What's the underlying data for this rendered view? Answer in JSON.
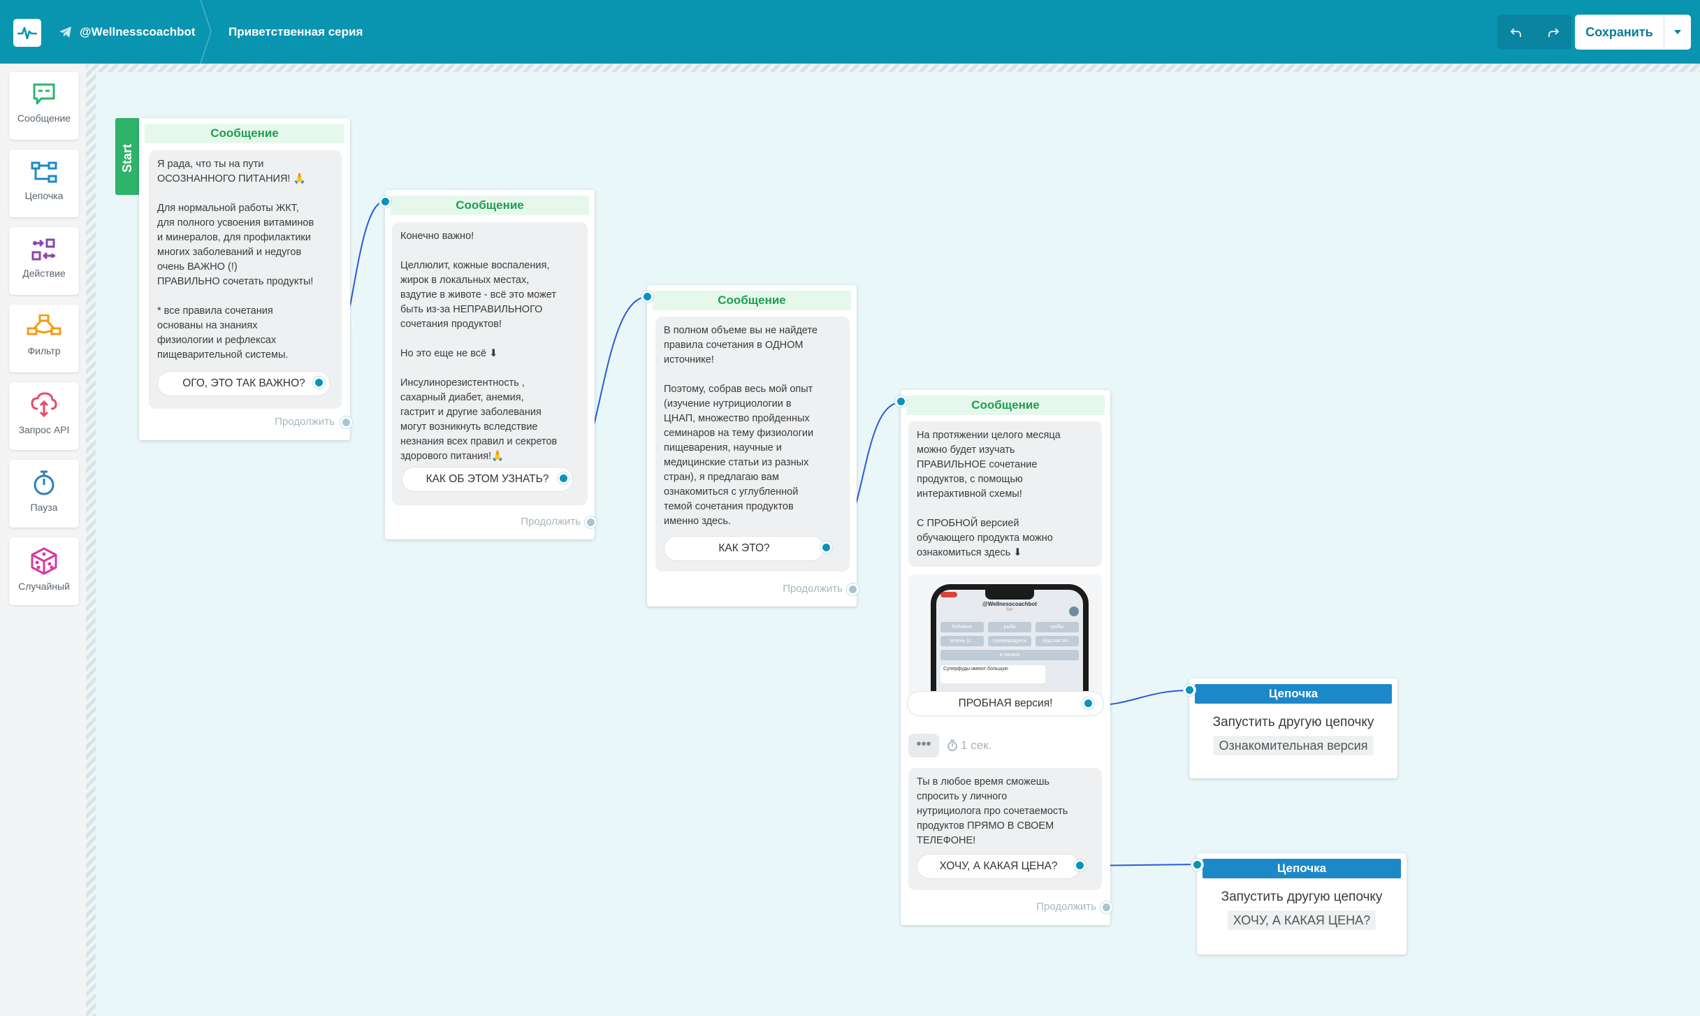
{
  "header": {
    "bot_name": "@Wellnesscoachbot",
    "page_title": "Приветственная серия",
    "save_label": "Сохранить"
  },
  "sidebar": {
    "items": [
      {
        "label": "Сообщение",
        "icon": "message-icon",
        "color": "#2db36a"
      },
      {
        "label": "Цепочка",
        "icon": "chain-icon",
        "color": "#1c88c8"
      },
      {
        "label": "Действие",
        "icon": "action-icon",
        "color": "#8e44ad"
      },
      {
        "label": "Фильтр",
        "icon": "filter-icon",
        "color": "#f39c12"
      },
      {
        "label": "Запрос API",
        "icon": "api-icon",
        "color": "#e74c6c"
      },
      {
        "label": "Пауза",
        "icon": "pause-icon",
        "color": "#2c7fb8"
      },
      {
        "label": "Случайный",
        "icon": "random-icon",
        "color": "#d63aa0"
      }
    ]
  },
  "flow": {
    "start_label": "Start",
    "continue_label": "Продолжить",
    "nodes": [
      {
        "title": "Сообщение",
        "text": "Я рада, что ты на пути\nОСОЗНАННОГО ПИТАНИЯ! 🙏\n\nДля нормальной работы ЖКТ,\nдля полного усвоения витаминов\nи минералов, для профилактики\nмногих заболеваний и недугов\nочень ВАЖНО (!)\nПРАВИЛЬНО сочетать продукты!\n\n* все правила сочетания\nоснованы на знаниях\nфизиологии и рефлексах\nпищеварительной системы.",
        "button": "ОГО, ЭТО ТАК ВАЖНО?"
      },
      {
        "title": "Сообщение",
        "text": "Конечно важно!\n\nЦеллюлит, кожные воспаления,\nжирок в локальных местах,\nвздутие в животе - всё это может\nбыть из-за НЕПРАВИЛЬНОГО\nсочетания продуктов!\n\nНо это еще не всё ⬇\n\nИнсулинорезистентность ,\nсахарный диабет, анемия,\nгастрит и другие заболевания\nмогут возникнуть вследствие\nнезнания всех правил и секретов\nздорового питания!🙏",
        "button": "КАК ОБ ЭТОМ УЗНАТЬ?"
      },
      {
        "title": "Сообщение",
        "text": "В полном объеме вы не найдете\nправила сочетания в ОДНОМ\nисточнике!\n\nПоэтому, собрав весь мой опыт\n(изучение нутрициологии в\nЦНАП, множество пройденных\nсеминаров на тему физиологии\nпищеварения, научные и\nмедицинские статьи из разных\nстран), я предлагаю вам\nознакомиться с углубленной\nтемой сочетания продуктов\nименно здесь.",
        "button": "КАК ЭТО?"
      },
      {
        "title": "Сообщение",
        "text": "На протяжении целого месяца\nможно будет изучать\nПРАВИЛЬНОЕ сочетание\nпродуктов, с помощью\nинтерактивной схемы!\n\nС ПРОБНОЙ версией\nобучающего продукта можно\nознакомиться здесь ⬇",
        "image_caption": {
          "bot": "@Wellnesscoachbot",
          "status": "бот",
          "keys": [
            "бобовые",
            "рыба",
            "грибы",
            "зелень (с...",
            "суперпродукты",
            "подсластит...",
            "в начало"
          ],
          "message_preview": "Суперфуды имеют большую"
        },
        "button": "ПРОБНАЯ версия!",
        "pause": "1 сек.",
        "text2": "Ты в любое время сможешь\nспросить у личного\nнутрициолога про сочетаемость\nпродуктов ПРЯМО В СВОЕМ\nТЕЛЕФОНЕ!",
        "button2": "ХОЧУ, А КАКАЯ ЦЕНА?"
      }
    ],
    "chains": [
      {
        "title": "Цепочка",
        "action": "Запустить другую цепочку",
        "target": "Ознакомительная версия"
      },
      {
        "title": "Цепочка",
        "action": "Запустить другую цепочку",
        "target": "ХОЧУ, А КАКАЯ ЦЕНА?"
      }
    ]
  },
  "colors": {
    "topbar": "#0995b0",
    "message_header": "#1e9e4e",
    "chain_header": "#1c88c8",
    "connector": "#2a5bd7",
    "port": "#0a93b6"
  }
}
